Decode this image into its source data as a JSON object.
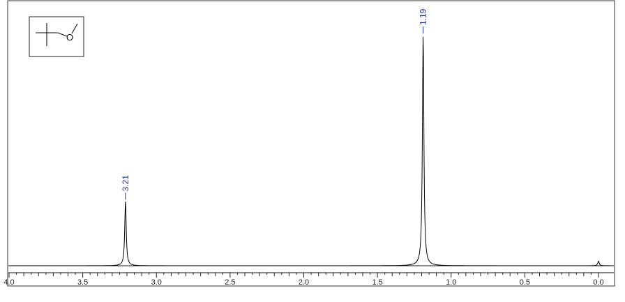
{
  "chart_data": {
    "type": "line",
    "title": "",
    "xlabel": "",
    "ylabel": "",
    "x_axis_reversed": true,
    "xlim": [
      4.0,
      0.0
    ],
    "x_tick_labels": [
      "4.0",
      "3.5",
      "3.0",
      "2.5",
      "2.0",
      "1.5",
      "1.0",
      "0.5",
      "0.0"
    ],
    "x_tick_values": [
      4.0,
      3.5,
      3.0,
      2.5,
      2.0,
      1.5,
      1.0,
      0.5,
      0.0
    ],
    "minor_tick_step": 0.05,
    "grid": false,
    "series": [
      {
        "peaks": [
          {
            "shift": 3.21,
            "intensity": 0.28,
            "label": "3.21"
          },
          {
            "shift": 1.19,
            "intensity": 1.0,
            "label": "1.19"
          },
          {
            "shift": 0.0,
            "intensity": 0.02,
            "label": ""
          }
        ]
      }
    ],
    "peak_labels": [
      "3.21",
      "1.19"
    ],
    "inset": {
      "type": "chemical-structure",
      "description_icon": "tert-butyl-methyl-ether-structure",
      "atom_label": "O"
    }
  }
}
